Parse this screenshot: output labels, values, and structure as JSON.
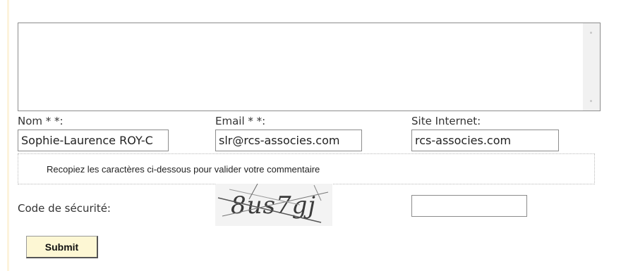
{
  "comment": {
    "value": ""
  },
  "fields": {
    "name": {
      "label": "Nom * *:",
      "value": "Sophie-Laurence ROY-C"
    },
    "email": {
      "label": "Email * *:",
      "value": "slr@rcs-associes.com"
    },
    "website": {
      "label": "Site Internet:",
      "value": "rcs-associes.com"
    }
  },
  "captcha": {
    "instruction": "Recopiez les caractères ci-dessous pour valider votre commentaire",
    "security_label": "Code de sécurité:",
    "image_text": "8us7gj",
    "input_value": ""
  },
  "submit": {
    "label": "Submit"
  },
  "colors": {
    "accent_rule": "#fdf3dc",
    "button_bg": "#fdf7d4"
  }
}
